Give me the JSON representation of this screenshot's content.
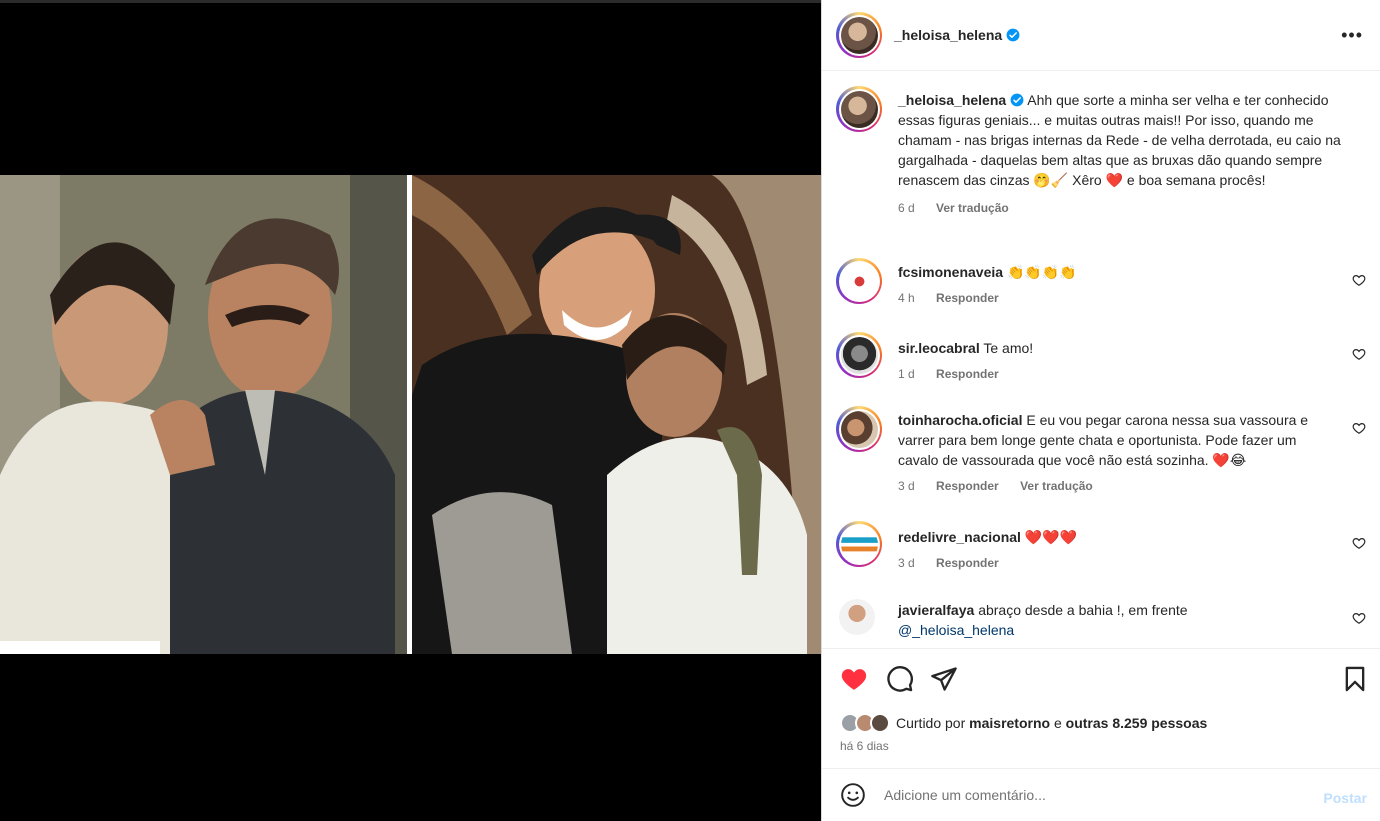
{
  "post": {
    "author": "_heloisa_helena",
    "verified": true,
    "caption": "Ahh que sorte a minha ser velha e ter conhecido essas figuras geniais... e muitas outras mais!! Por isso, quando me chamam - nas brigas internas da Rede - de velha derrotada, eu caio na gargalhada - daquelas bem altas que as bruxas dão quando sempre renascem das cinzas 🤭🧹 Xêro ❤️ e boa semana procês!",
    "caption_time": "6 d",
    "caption_translate": "Ver tradução"
  },
  "comments": [
    {
      "user": "fcsimonenaveia",
      "text": "👏👏👏👏",
      "time": "4 h",
      "reply": "Responder"
    },
    {
      "user": "sir.leocabral",
      "text": "Te amo!",
      "time": "1 d",
      "reply": "Responder"
    },
    {
      "user": "toinharocha.oficial",
      "text": "E eu vou pegar carona nessa sua vassoura e varrer para bem longe gente chata e oportunista. Pode fazer um cavalo de vassourada que você não está sozinha. ❤️😂",
      "time": "3 d",
      "reply": "Responder",
      "translate": "Ver tradução"
    },
    {
      "user": "redelivre_nacional",
      "text": "❤️❤️❤️",
      "time": "3 d",
      "reply": "Responder"
    },
    {
      "user": "javieralfaya",
      "text": "abraço desde a bahia !, em frente",
      "mention": "@_heloisa_helena"
    }
  ],
  "likes": {
    "prefix": "Curtido por",
    "user": "maisretorno",
    "connector": "e",
    "others": "outras 8.259 pessoas"
  },
  "date": "há 6 dias",
  "add_comment": {
    "placeholder": "Adicione um comentário...",
    "post_label": "Postar"
  },
  "colors": {
    "like_red": "#ff3040",
    "verified_blue": "#0095f6",
    "post_disabled": "#c0dffd"
  },
  "icons": [
    "more-options-icon",
    "verified-icon",
    "heart-filled-icon",
    "comment-icon",
    "share-icon",
    "bookmark-icon",
    "emoji-icon",
    "heart-outline-icon"
  ]
}
